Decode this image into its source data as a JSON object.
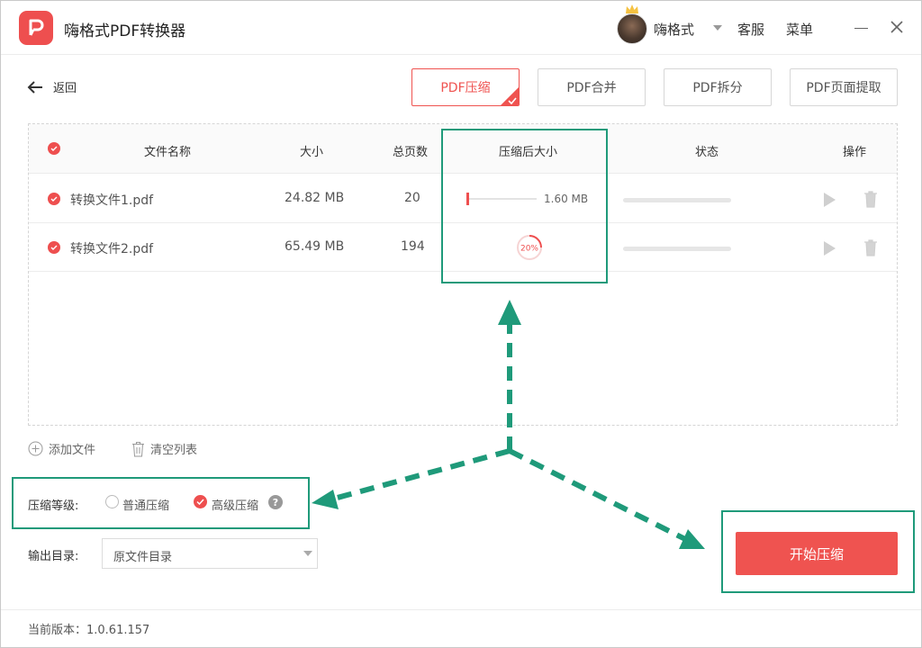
{
  "app": {
    "title": "嗨格式PDF转换器",
    "username": "嗨格式",
    "service_label": "客服",
    "menu_label": "菜单"
  },
  "toolbar": {
    "back_label": "返回",
    "tabs": [
      {
        "label": "PDF压缩",
        "active": true
      },
      {
        "label": "PDF合并",
        "active": false
      },
      {
        "label": "PDF拆分",
        "active": false
      },
      {
        "label": "PDF页面提取",
        "active": false
      }
    ]
  },
  "table": {
    "headers": {
      "name": "文件名称",
      "size": "大小",
      "pages": "总页数",
      "compressed_size": "压缩后大小",
      "status": "状态",
      "actions": "操作"
    },
    "rows": [
      {
        "name": "转换文件1.pdf",
        "size": "24.82 MB",
        "pages": "20",
        "compressed_size": "1.60 MB"
      },
      {
        "name": "转换文件2.pdf",
        "size": "65.49 MB",
        "pages": "194",
        "progress": "20%"
      }
    ]
  },
  "list_actions": {
    "add_file": "添加文件",
    "clear_list": "清空列表"
  },
  "compression": {
    "label": "压缩等级:",
    "options": [
      {
        "label": "普通压缩",
        "selected": false
      },
      {
        "label": "高级压缩",
        "selected": true
      }
    ],
    "help": "?"
  },
  "output": {
    "label": "输出目录:",
    "value": "原文件目录"
  },
  "start_button": "开始压缩",
  "footer": {
    "version": "当前版本：1.0.61.157"
  },
  "colors": {
    "accent": "#ef5350",
    "highlight": "#1f9a7a"
  }
}
